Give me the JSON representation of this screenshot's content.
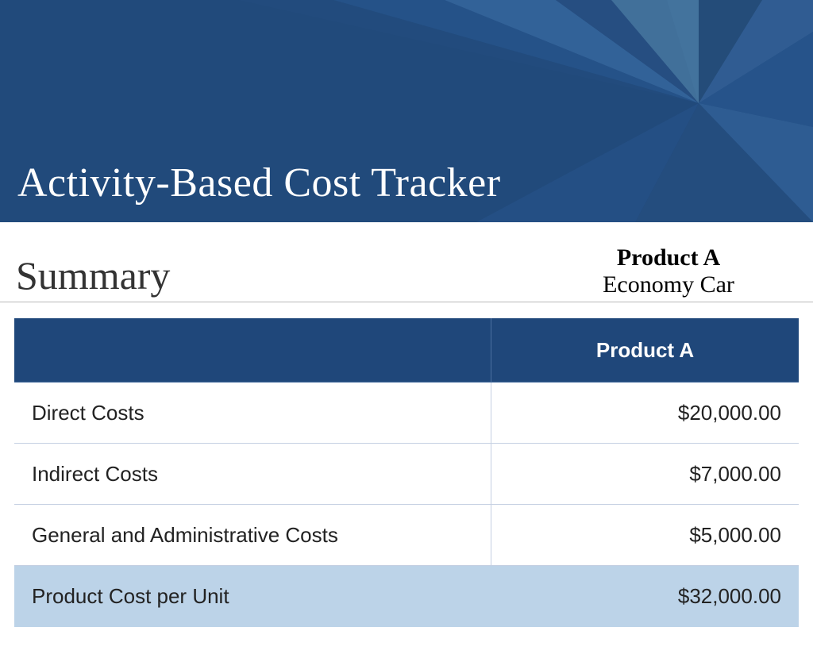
{
  "banner": {
    "title": "Activity-Based Cost Tracker"
  },
  "summary": {
    "heading": "Summary",
    "product_label": "Product A",
    "product_desc": "Economy Car"
  },
  "table": {
    "column_blank": "",
    "column_product": "Product A",
    "rows": [
      {
        "label": "Direct Costs",
        "value": "$20,000.00"
      },
      {
        "label": "Indirect Costs",
        "value": "$7,000.00"
      },
      {
        "label": "General and Administrative Costs",
        "value": "$5,000.00"
      }
    ],
    "total_row": {
      "label": "Product Cost per Unit",
      "value": "$32,000.00"
    }
  },
  "chart_data": {
    "type": "table",
    "title": "Activity-Based Cost Tracker — Summary",
    "categories": [
      "Direct Costs",
      "Indirect Costs",
      "General and Administrative Costs",
      "Product Cost per Unit"
    ],
    "series": [
      {
        "name": "Product A (Economy Car)",
        "values": [
          20000.0,
          7000.0,
          5000.0,
          32000.0
        ]
      }
    ],
    "currency": "USD"
  }
}
